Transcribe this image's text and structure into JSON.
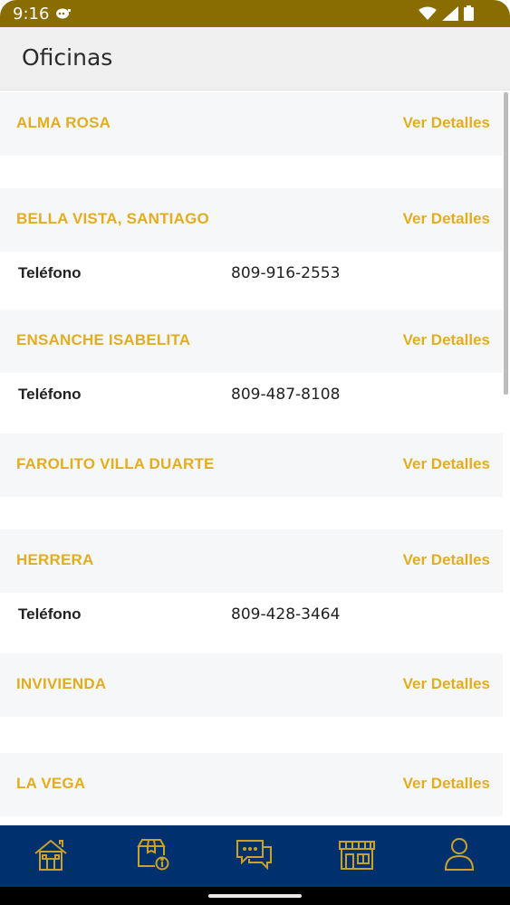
{
  "status_bar": {
    "time": "9:16"
  },
  "header": {
    "title": "Oficinas"
  },
  "offices": [
    {
      "name": "ALMA ROSA",
      "link": "Ver Detalles"
    },
    {
      "name": "BELLA VISTA, SANTIAGO",
      "link": "Ver Detalles",
      "phone_label": "Teléfono",
      "phone": "809-916-2553"
    },
    {
      "name": "ENSANCHE ISABELITA",
      "link": "Ver Detalles",
      "phone_label": "Teléfono",
      "phone": "809-487-8108"
    },
    {
      "name": "FAROLITO VILLA DUARTE",
      "link": "Ver Detalles"
    },
    {
      "name": "HERRERA",
      "link": "Ver Detalles",
      "phone_label": "Teléfono",
      "phone": "809-428-3464"
    },
    {
      "name": "INVIVIENDA",
      "link": "Ver Detalles"
    },
    {
      "name": "LA VEGA",
      "link": "Ver Detalles"
    }
  ],
  "bottom_nav": [
    {
      "icon": "home-icon"
    },
    {
      "icon": "package-info-icon"
    },
    {
      "icon": "chat-icon"
    },
    {
      "icon": "store-icon",
      "active": true
    },
    {
      "icon": "user-icon"
    }
  ],
  "colors": {
    "status_bar": "#8a6d00",
    "accent": "#e2ad1f",
    "nav_background": "#00306e",
    "nav_icon": "#c9a227"
  }
}
